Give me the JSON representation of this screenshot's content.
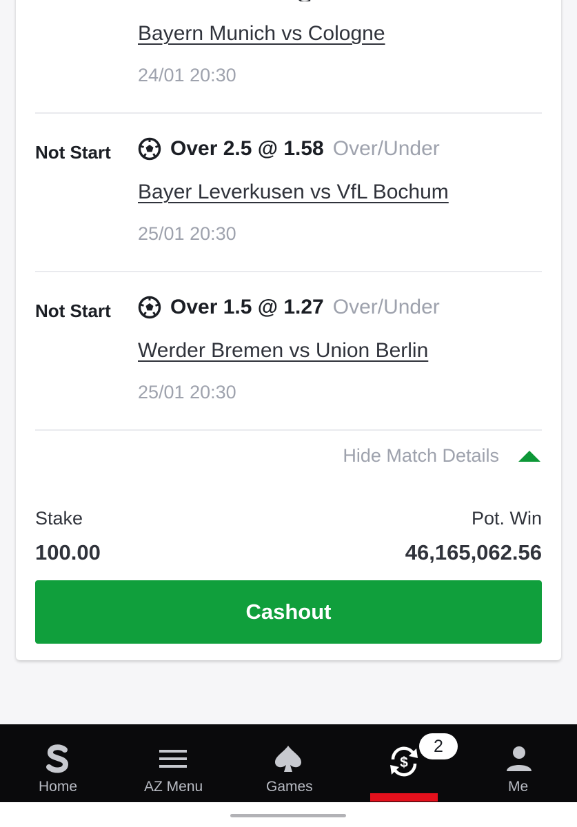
{
  "bets": {
    "partial": {
      "match": "Bayern Munich vs Cologne",
      "time": "24/01 20:30"
    },
    "rows": [
      {
        "status": "Not Start",
        "selection": "Over 2.5 @ 1.58",
        "market": "Over/Under",
        "match": "Bayer Leverkusen vs VfL Bochum",
        "time": "25/01 20:30",
        "icon": "soccer-ball-icon"
      },
      {
        "status": "Not Start",
        "selection": "Over 1.5 @ 1.27",
        "market": "Over/Under",
        "match": "Werder Bremen vs Union Berlin",
        "time": "25/01 20:30",
        "icon": "soccer-ball-icon"
      }
    ]
  },
  "details_toggle": {
    "label": "Hide Match Details",
    "icon": "caret-up-icon"
  },
  "summary": {
    "stake_label": "Stake",
    "stake_value": "100.00",
    "win_label": "Pot. Win",
    "win_value": "46,165,062.56"
  },
  "cashout": {
    "label": "Cashout"
  },
  "nav": {
    "items": [
      {
        "label": "Home",
        "icon": "sportybet-s-icon"
      },
      {
        "label": "AZ Menu",
        "icon": "hamburger-menu-icon"
      },
      {
        "label": "Games",
        "icon": "spade-icon"
      },
      {
        "label": "",
        "icon": "cashout-cycle-icon"
      },
      {
        "label": "Me",
        "icon": "user-icon"
      }
    ],
    "badge": "2",
    "active_index": 3
  },
  "colors": {
    "brand_green": "#109f3c",
    "active_red": "#e4101c",
    "nav_background": "#0a0a0c",
    "muted_text": "#9ea2ad"
  }
}
